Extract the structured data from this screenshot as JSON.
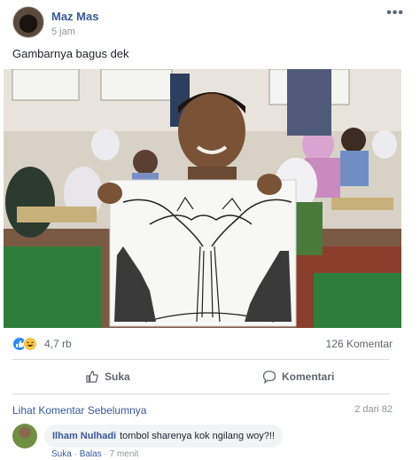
{
  "post": {
    "author": "Maz Mas",
    "time": "5 jam",
    "more_icon": "ellipsis-icon",
    "text": "Gambarnya bagus dek"
  },
  "stats": {
    "reaction_icons": [
      "like-icon",
      "haha-icon"
    ],
    "reaction_count": "4,7 rb",
    "comment_count": "126 Komentar"
  },
  "actions": {
    "like_label": "Suka",
    "comment_label": "Komentari"
  },
  "comments": {
    "previous_label": "Lihat Komentar Sebelumnya",
    "pager": "2 dari 82",
    "items": [
      {
        "author": "Ilham Nulhadi",
        "text": "tombol sharenya kok ngilang woy?!!",
        "like_label": "Suka",
        "reply_label": "Balas",
        "time": "7 menit"
      }
    ]
  },
  "colors": {
    "link": "#385898",
    "muted": "#606770",
    "meta": "#90949c",
    "like_blue": "#2d88ff",
    "haha_yellow": "#f7c649",
    "bubble": "#f2f3f5"
  }
}
